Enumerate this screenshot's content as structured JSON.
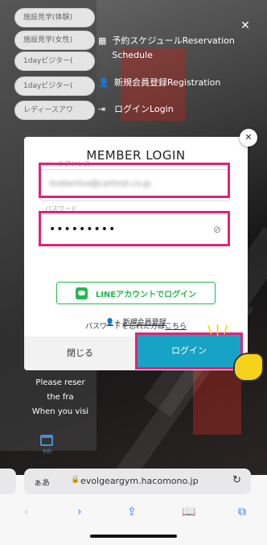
{
  "bg_chips": [
    "施設見学(体験)",
    "施設見学(女性)",
    "1dayビジター(",
    "1dayビジター(",
    "レディースアワ"
  ],
  "menu": {
    "items": [
      {
        "icon": "calendar-icon",
        "label": "予約スケジュールReservation Schedule"
      },
      {
        "icon": "add-user-icon",
        "label": "新規会員登録Registration"
      },
      {
        "icon": "login-icon",
        "label": "ログインLogin"
      }
    ]
  },
  "below_text": [
    "Please reser",
    "the fra",
    "When you visi"
  ],
  "calendar_label": "予約",
  "modal": {
    "title": "MEMBER LOGIN",
    "email_label": "メールアドレス",
    "email_value": "liveberlive@carlinot.co.jp",
    "password_label": "パスワード",
    "password_value": "•••••••••",
    "line_button": "LINEアカウントでログイン",
    "register_link": "新規会員登録",
    "forgot_prefix": "パスワードを忘れた方は",
    "forgot_link": "こちら",
    "close_button": "閉じる",
    "login_button": "ログイン"
  },
  "browser": {
    "aa": "ぁあ",
    "url": "evolgeargym.hacomono.jp"
  },
  "colors": {
    "highlight": "#e0237b",
    "line_green": "#21b94c",
    "login_blue": "#17a3c6"
  }
}
